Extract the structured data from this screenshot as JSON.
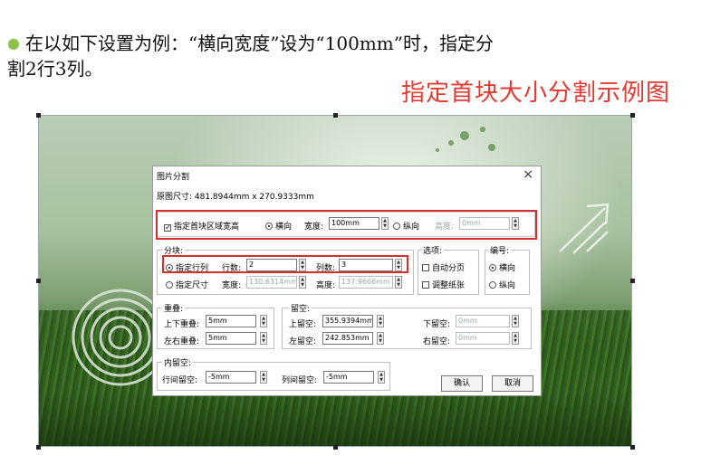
{
  "slide": {
    "bullet_line1": "在以如下设置为例：“横向宽度”设为“100mm”时，指定分",
    "bullet_line2": "割2行3列。",
    "caption": "指定首块大小分割示例图"
  },
  "dialog": {
    "title": "图片分割",
    "close_glyph": "×",
    "original_size": "原图尺寸: 481.8944mm x 270.9333mm",
    "first_block": {
      "check_label": "指定首块区域宽高",
      "horizontal_label": "横向",
      "width_label": "宽度:",
      "width_value": "100mm",
      "vertical_label": "纵向",
      "height_label": "高度:",
      "height_value": "0mm"
    },
    "split": {
      "group_title": "分块:",
      "rowcol_label": "指定行列",
      "rows_label": "行数:",
      "rows_value": "2",
      "cols_label": "列数:",
      "cols_value": "3",
      "size_label": "指定尺寸",
      "width_label": "宽度:",
      "width_value": "130.6314mm",
      "height_label": "高度:",
      "height_value": "137.9666mm"
    },
    "options": {
      "group_title": "选项:",
      "auto_page": "自动分页",
      "adjust_paper": "调整纸张"
    },
    "numbering": {
      "group_title": "编号:",
      "horizontal": "横向",
      "vertical": "纵向"
    },
    "overlap": {
      "group_title": "重叠:",
      "top_bottom_label": "上下重叠:",
      "top_bottom_value": "5mm",
      "left_right_label": "左右重叠:",
      "left_right_value": "5mm"
    },
    "margin": {
      "group_title": "留空:",
      "top_label": "上留空:",
      "top_value": "355.9394mm",
      "left_label": "左留空:",
      "left_value": "242.853mm",
      "bottom_label": "下留空:",
      "bottom_value": "0mm",
      "right_label": "右留空:",
      "right_value": "0mm"
    },
    "inner": {
      "group_title": "内留空:",
      "row_gap_label": "行间留空:",
      "row_gap_value": "-5mm",
      "col_gap_label": "列间留空:",
      "col_gap_value": "-5mm"
    },
    "ok_label": "确认",
    "cancel_label": "取消"
  },
  "colors": {
    "bullet": "#8bc34a",
    "caption": "#e53935",
    "highlight_box": "#d32f2f"
  }
}
